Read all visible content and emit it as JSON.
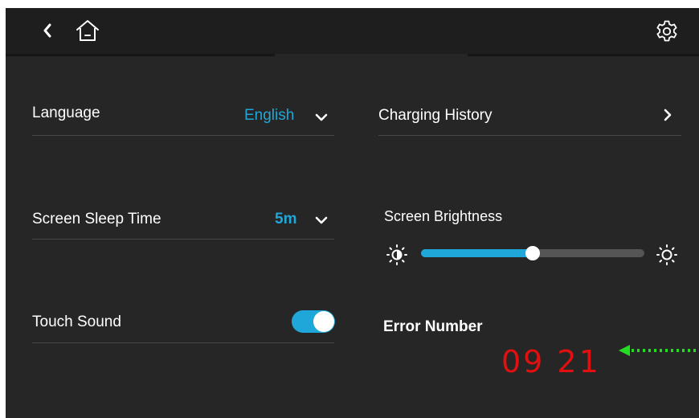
{
  "header": {
    "back_icon": "chevron-left-icon",
    "home_icon": "home-icon",
    "settings_icon": "gear-icon"
  },
  "settings": {
    "language": {
      "label": "Language",
      "value": "English"
    },
    "charging_history": {
      "label": "Charging History"
    },
    "screen_sleep": {
      "label": "Screen Sleep Time",
      "value": "5m"
    },
    "screen_brightness": {
      "label": "Screen Brightness",
      "level_percent": 50
    },
    "touch_sound": {
      "label": "Touch Sound",
      "enabled": true
    },
    "error": {
      "label": "Error Number",
      "code": "09 21"
    }
  },
  "colors": {
    "accent": "#1ea7d8",
    "error": "#e01010",
    "annotation_arrow": "#22dd22",
    "background": "#262626"
  }
}
